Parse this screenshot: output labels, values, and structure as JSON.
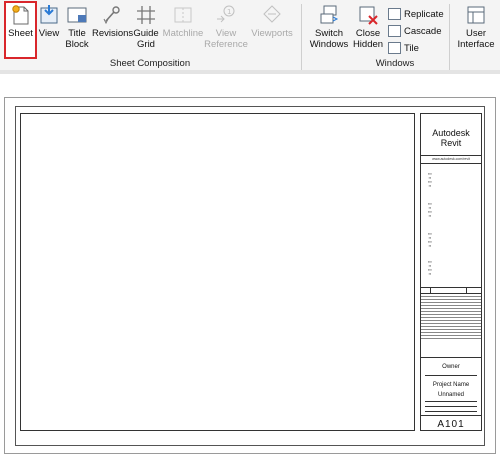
{
  "ribbon": {
    "sheet_composition": {
      "label": "Sheet Composition",
      "buttons": [
        {
          "label": "Sheet",
          "icon": "new-sheet-icon",
          "selected": true
        },
        {
          "label": "View",
          "icon": "place-view-icon"
        },
        {
          "label": "Title Block",
          "icon": "title-block-icon"
        },
        {
          "label": "Revisions",
          "icon": "revisions-icon"
        },
        {
          "label": "Guide Grid",
          "icon": "guide-grid-icon"
        },
        {
          "label": "Matchline",
          "icon": "matchline-icon",
          "disabled": true
        },
        {
          "label": "View Reference",
          "icon": "view-reference-icon",
          "disabled": true
        },
        {
          "label": "Viewports",
          "icon": "viewports-icon",
          "disabled": true
        }
      ]
    },
    "windows": {
      "label": "Windows",
      "switch_windows": "Switch Windows",
      "close_hidden": "Close Hidden",
      "replicate": "Replicate",
      "cascade": "Cascade",
      "tile": "Tile",
      "user_interface": "User Interface"
    }
  },
  "title_block": {
    "company": "Autodesk Revit",
    "url": "www.autodesk.com/revit",
    "owner": "Owner",
    "project_name": "Project Name",
    "sheet_name": "Unnamed",
    "sheet_number": "A101"
  },
  "colors": {
    "selection_outline": "#d9262b",
    "ribbon_bg": "#f4f4f4"
  }
}
